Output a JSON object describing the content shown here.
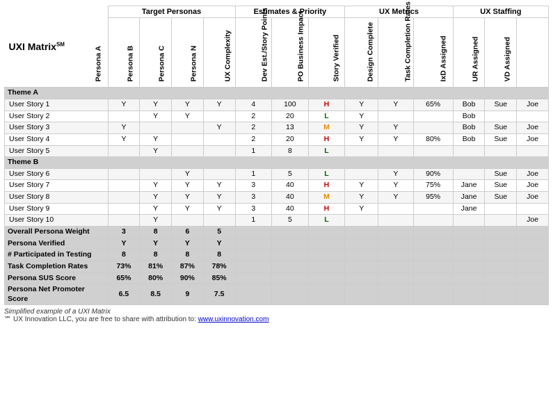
{
  "title": "UXI Matrix",
  "title_superscript": "SM",
  "groups": {
    "target_personas": "Target Personas",
    "estimates_priority": "Estimates & Priority",
    "ux_metrics": "UX Metrics",
    "ux_staffing": "UX Staffing"
  },
  "columns": {
    "persona_a": "Persona A",
    "persona_b": "Persona B",
    "persona_c": "Persona C",
    "persona_n": "Persona N",
    "ux_complexity": "UX Complexity",
    "dev_est": "Dev Est./Story Points",
    "po_impact": "PO Business Impact",
    "story_verified": "Story Verified",
    "design_complete": "Design Complete",
    "task_completion": "Task Completion Rates",
    "ixd_assigned": "IxD Assigned",
    "ur_assigned": "UR Assigned",
    "vd_assigned": "VD Assigned"
  },
  "themes": [
    {
      "name": "Theme A",
      "stories": [
        {
          "name": "User Story 1",
          "pa": "Y",
          "pb": "Y",
          "pc": "Y",
          "pn": "Y",
          "ux": "4",
          "dev": "100",
          "po": "H",
          "sv": "Y",
          "dc": "Y",
          "tcr": "65%",
          "ixd": "Bob",
          "ur": "Sue",
          "vd": "Joe"
        },
        {
          "name": "User Story 2",
          "pa": "",
          "pb": "Y",
          "pc": "Y",
          "pn": "",
          "ux": "2",
          "dev": "20",
          "po": "L",
          "sv": "Y",
          "dc": "",
          "tcr": "",
          "ixd": "Bob",
          "ur": "",
          "vd": ""
        },
        {
          "name": "User Story 3",
          "pa": "Y",
          "pb": "",
          "pc": "",
          "pn": "Y",
          "ux": "2",
          "dev": "13",
          "po": "M",
          "sv": "Y",
          "dc": "Y",
          "tcr": "",
          "ixd": "Bob",
          "ur": "Sue",
          "vd": "Joe"
        },
        {
          "name": "User Story 4",
          "pa": "Y",
          "pb": "Y",
          "pc": "",
          "pn": "",
          "ux": "2",
          "dev": "20",
          "po": "H",
          "sv": "Y",
          "dc": "Y",
          "tcr": "80%",
          "ixd": "Bob",
          "ur": "Sue",
          "vd": "Joe"
        },
        {
          "name": "User Story 5",
          "pa": "",
          "pb": "Y",
          "pc": "",
          "pn": "",
          "ux": "1",
          "dev": "8",
          "po": "L",
          "sv": "",
          "dc": "",
          "tcr": "",
          "ixd": "",
          "ur": "",
          "vd": ""
        }
      ]
    },
    {
      "name": "Theme B",
      "stories": [
        {
          "name": "User Story 6",
          "pa": "",
          "pb": "",
          "pc": "Y",
          "pn": "",
          "ux": "1",
          "dev": "5",
          "po": "L",
          "sv": "",
          "dc": "Y",
          "tcr": "90%",
          "ixd": "",
          "ur": "Sue",
          "vd": "Joe"
        },
        {
          "name": "User Story 7",
          "pa": "",
          "pb": "Y",
          "pc": "Y",
          "pn": "Y",
          "ux": "3",
          "dev": "40",
          "po": "H",
          "sv": "Y",
          "dc": "Y",
          "tcr": "75%",
          "ixd": "Jane",
          "ur": "Sue",
          "vd": "Joe"
        },
        {
          "name": "User Story 8",
          "pa": "",
          "pb": "Y",
          "pc": "Y",
          "pn": "Y",
          "ux": "3",
          "dev": "40",
          "po": "M",
          "sv": "Y",
          "dc": "Y",
          "tcr": "95%",
          "ixd": "Jane",
          "ur": "Sue",
          "vd": "Joe"
        },
        {
          "name": "User Story 9",
          "pa": "",
          "pb": "Y",
          "pc": "Y",
          "pn": "Y",
          "ux": "3",
          "dev": "40",
          "po": "H",
          "sv": "Y",
          "dc": "",
          "tcr": "",
          "ixd": "Jane",
          "ur": "",
          "vd": ""
        },
        {
          "name": "User Story 10",
          "pa": "",
          "pb": "Y",
          "pc": "",
          "pn": "",
          "ux": "1",
          "dev": "5",
          "po": "L",
          "sv": "",
          "dc": "",
          "tcr": "",
          "ixd": "",
          "ur": "",
          "vd": "Joe"
        }
      ]
    }
  ],
  "summary": [
    {
      "label": "Overall Persona Weight",
      "pa": "3",
      "pb": "8",
      "pc": "6",
      "pn": "5",
      "rest": [
        "",
        "",
        "",
        "",
        "",
        "",
        "",
        "",
        ""
      ]
    },
    {
      "label": "Persona Verified",
      "pa": "Y",
      "pb": "Y",
      "pc": "Y",
      "pn": "Y",
      "rest": [
        "",
        "",
        "",
        "",
        "",
        "",
        "",
        "",
        ""
      ]
    },
    {
      "label": "# Participated in Testing",
      "pa": "8",
      "pb": "8",
      "pc": "8",
      "pn": "8",
      "rest": [
        "",
        "",
        "",
        "",
        "",
        "",
        "",
        "",
        ""
      ]
    },
    {
      "label": "Task Completion Rates",
      "pa": "73%",
      "pb": "81%",
      "pc": "87%",
      "pn": "78%",
      "rest": [
        "",
        "",
        "",
        "",
        "",
        "",
        "",
        "",
        ""
      ]
    },
    {
      "label": "Persona SUS Score",
      "pa": "65%",
      "pb": "80%",
      "pc": "90%",
      "pn": "85%",
      "rest": [
        "",
        "",
        "",
        "",
        "",
        "",
        "",
        "",
        ""
      ]
    },
    {
      "label": "Persona Net Promoter Score",
      "pa": "6.5",
      "pb": "8.5",
      "pc": "9",
      "pn": "7.5",
      "rest": [
        "",
        "",
        "",
        "",
        "",
        "",
        "",
        "",
        ""
      ]
    }
  ],
  "footer": {
    "simplified": "Simplified example of a UXI Matrix",
    "copyright": "℠ UX Innovation LLC, you are free to share with attribution to:",
    "link_text": "www.uxinnovation.com",
    "link_url": "www.uxinnovation.com"
  }
}
